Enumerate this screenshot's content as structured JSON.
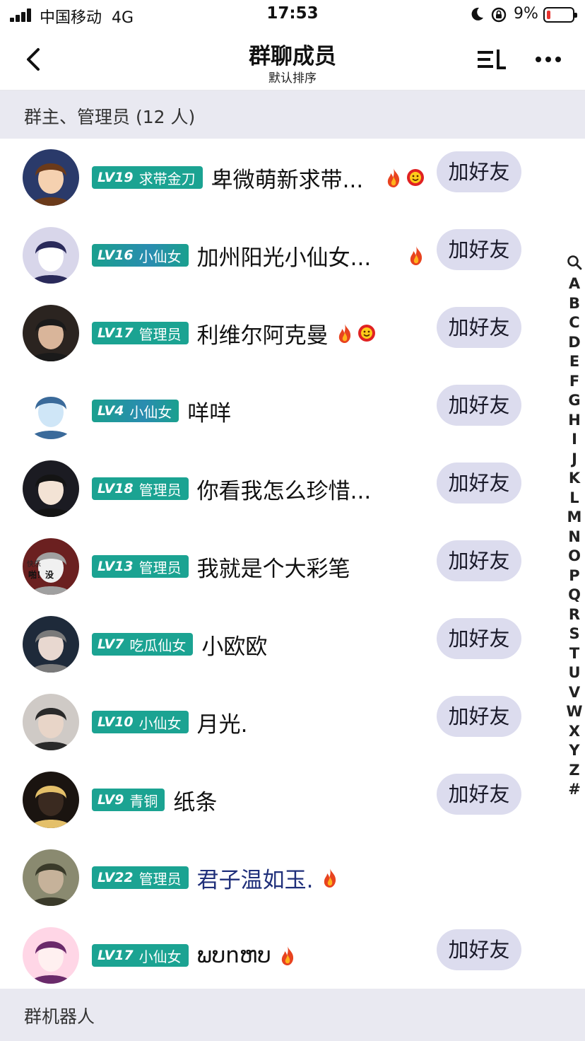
{
  "status": {
    "carrier": "中国移动",
    "network": "4G",
    "time": "17:53",
    "battery": "9%",
    "battery_level": 0.09
  },
  "nav": {
    "title": "群聊成员",
    "subtitle": "默认排序",
    "back_icon": "chevron-left-icon",
    "sort_icon": "sort-icon",
    "more_icon": "more-icon"
  },
  "sections": {
    "admins": "群主、管理员 (12 人)",
    "bots": "群机器人"
  },
  "add_friend_label": "加好友",
  "members": [
    {
      "lv": "LV19",
      "title": "求带金刀",
      "name": "卑微萌新求带...",
      "icons": [
        "fire",
        "smile"
      ],
      "add_friend": true
    },
    {
      "lv": "LV16",
      "title": "小仙女",
      "name": "加州阳光小仙女...",
      "icons": [
        "fire"
      ],
      "add_friend": true,
      "special": true
    },
    {
      "lv": "LV17",
      "title": "管理员",
      "name": "利维尔阿克曼",
      "icons": [
        "fire",
        "smile"
      ],
      "add_friend": true
    },
    {
      "lv": "LV4",
      "title": "小仙女",
      "name": "咩咩",
      "icons": [],
      "add_friend": true,
      "special": true
    },
    {
      "lv": "LV18",
      "title": "管理员",
      "name": "你看我怎么珍惜...",
      "icons": [],
      "add_friend": true
    },
    {
      "lv": "LV13",
      "title": "管理员",
      "name": "我就是个大彩笔",
      "icons": [],
      "add_friend": true,
      "avatar_text": [
        "快乐",
        "啪！没"
      ]
    },
    {
      "lv": "LV7",
      "title": "吃瓜仙女",
      "name": "小欧欧",
      "icons": [],
      "add_friend": true
    },
    {
      "lv": "LV10",
      "title": "小仙女",
      "name": "月光.",
      "icons": [],
      "add_friend": true
    },
    {
      "lv": "LV9",
      "title": "青铜",
      "name": "纸条",
      "icons": [],
      "add_friend": true
    },
    {
      "lv": "LV22",
      "title": "管理员",
      "name": "君子温如玉.",
      "icons": [
        "fire"
      ],
      "add_friend": false,
      "blue": true
    },
    {
      "lv": "LV17",
      "title": "小仙女",
      "name": "ພບnຫບ",
      "icons": [
        "fire"
      ],
      "add_friend": true
    }
  ],
  "index_letters": [
    "A",
    "B",
    "C",
    "D",
    "E",
    "F",
    "G",
    "H",
    "I",
    "J",
    "K",
    "L",
    "M",
    "N",
    "O",
    "P",
    "Q",
    "R",
    "S",
    "T",
    "U",
    "V",
    "W",
    "X",
    "Y",
    "Z",
    "#"
  ],
  "colors": {
    "badge": "#1ba392",
    "section_bg": "#e9e9f1",
    "button_bg": "#dcdcee"
  }
}
